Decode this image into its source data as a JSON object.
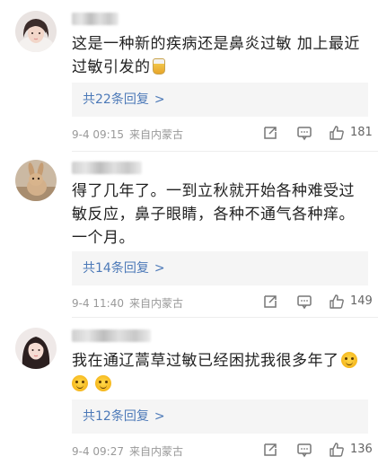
{
  "comments": [
    {
      "avatar_icon": "user-avatar-girl",
      "text": "这是一种新的疾病还是鼻炎过敏 加上最近过敏引发的",
      "emoji": "glass-icon",
      "reply_label": "共22条回复",
      "reply_chevron": ">",
      "date": "9-4 09:15",
      "location": "来自内蒙古",
      "like_count": "181"
    },
    {
      "avatar_icon": "user-avatar-rabbit",
      "text": "得了几年了。一到立秋就开始各种难受过敏反应，鼻子眼睛，各种不通气各种痒。一个月。",
      "reply_label": "共14条回复",
      "reply_chevron": ">",
      "date": "9-4 11:40",
      "location": "来自内蒙古",
      "like_count": "149"
    },
    {
      "avatar_icon": "user-avatar-girl-2",
      "text": "我在通辽蒿草过敏已经困扰我很多年了",
      "emoji": "smile-icon",
      "reply_label": "共12条回复",
      "reply_chevron": ">",
      "date": "9-4 09:27",
      "location": "来自内蒙古",
      "like_count": "136"
    }
  ]
}
